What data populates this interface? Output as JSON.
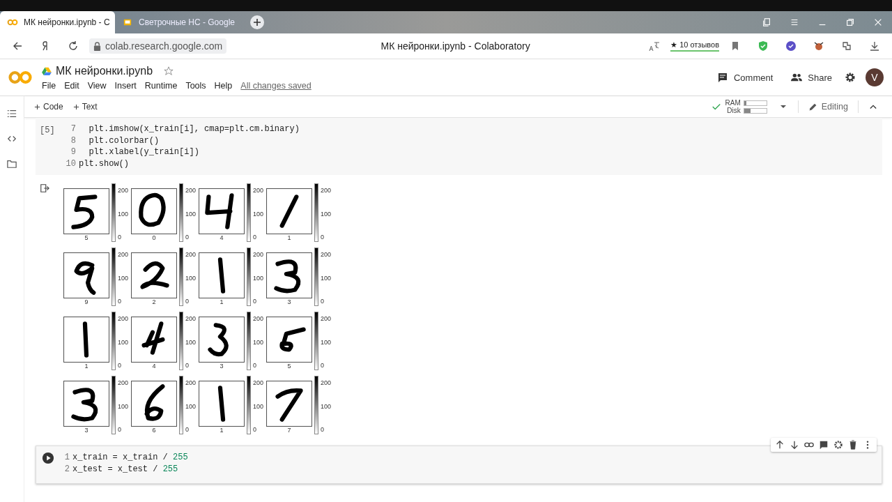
{
  "browser": {
    "tabs": [
      {
        "title": "МК нейронки.ipynb - C",
        "selected": true
      },
      {
        "title": "Светрочные НС - Google",
        "selected": false
      }
    ],
    "url": "colab.research.google.com",
    "page_title": "МК нейронки.ipynb - Colaboratory",
    "reviews": "★ 10 отзывов"
  },
  "header": {
    "notebook_title": "МК нейронки.ipynb",
    "menu": [
      "File",
      "Edit",
      "View",
      "Insert",
      "Runtime",
      "Tools",
      "Help"
    ],
    "save_status": "All changes saved",
    "actions": [
      "Comment",
      "Share"
    ],
    "avatar": "V"
  },
  "toolbar": {
    "add": [
      "Code",
      "Text"
    ],
    "resources": [
      {
        "label": "RAM",
        "level": 0.1
      },
      {
        "label": "Disk",
        "level": 0.3
      }
    ],
    "mode": "Editing"
  },
  "cell_1": {
    "exec_count": "[5]",
    "lines": [
      {
        "num": "7",
        "tokens": [
          {
            "text": "  plt.imshow(x_train[i], cmap=plt.cm.binary)",
            "kind": "plain"
          }
        ]
      },
      {
        "num": "8",
        "tokens": [
          {
            "text": "  plt.colorbar()",
            "kind": "plain"
          }
        ]
      },
      {
        "num": "9",
        "tokens": [
          {
            "text": "  plt.xlabel(y_train[i])",
            "kind": "plain"
          }
        ]
      },
      {
        "num": "10",
        "tokens": [
          {
            "text": "plt.show()",
            "kind": "plain"
          }
        ]
      }
    ],
    "output": {
      "panels": [
        {
          "label": "5",
          "ticks": [
            "200",
            "100",
            "0"
          ]
        },
        {
          "label": "0",
          "ticks": [
            "200",
            "100",
            "0"
          ]
        },
        {
          "label": "4",
          "ticks": [
            "200",
            "100",
            "0"
          ]
        },
        {
          "label": "1",
          "ticks": [
            "200",
            "100",
            "0"
          ]
        },
        {
          "label": "9",
          "ticks": [
            "200",
            "100",
            "0"
          ]
        },
        {
          "label": "2",
          "ticks": [
            "200",
            "100",
            "0"
          ]
        },
        {
          "label": "1",
          "ticks": [
            "200",
            "100",
            "0"
          ]
        },
        {
          "label": "3",
          "ticks": [
            "200",
            "100",
            "0"
          ]
        },
        {
          "label": "1",
          "ticks": [
            "200",
            "100",
            "0"
          ]
        },
        {
          "label": "4",
          "ticks": [
            "200",
            "100",
            "0"
          ]
        },
        {
          "label": "3",
          "ticks": [
            "200",
            "100",
            "0"
          ]
        },
        {
          "label": "5",
          "ticks": [
            "200",
            "100",
            "0"
          ]
        },
        {
          "label": "3",
          "ticks": [
            "200",
            "100",
            "0"
          ]
        },
        {
          "label": "6",
          "ticks": [
            "200",
            "100",
            "0"
          ]
        },
        {
          "label": "1",
          "ticks": [
            "200",
            "100",
            "0"
          ]
        },
        {
          "label": "7",
          "ticks": [
            "200",
            "100",
            "0"
          ]
        }
      ]
    }
  },
  "cell_2": {
    "lines": [
      {
        "num": "1",
        "tokens": [
          {
            "text": "x_train = x_train / ",
            "kind": "plain"
          },
          {
            "text": "255",
            "kind": "number"
          }
        ]
      },
      {
        "num": "2",
        "tokens": [
          {
            "text": "x_test = x_test / ",
            "kind": "plain"
          },
          {
            "text": "255",
            "kind": "number"
          }
        ]
      }
    ]
  }
}
